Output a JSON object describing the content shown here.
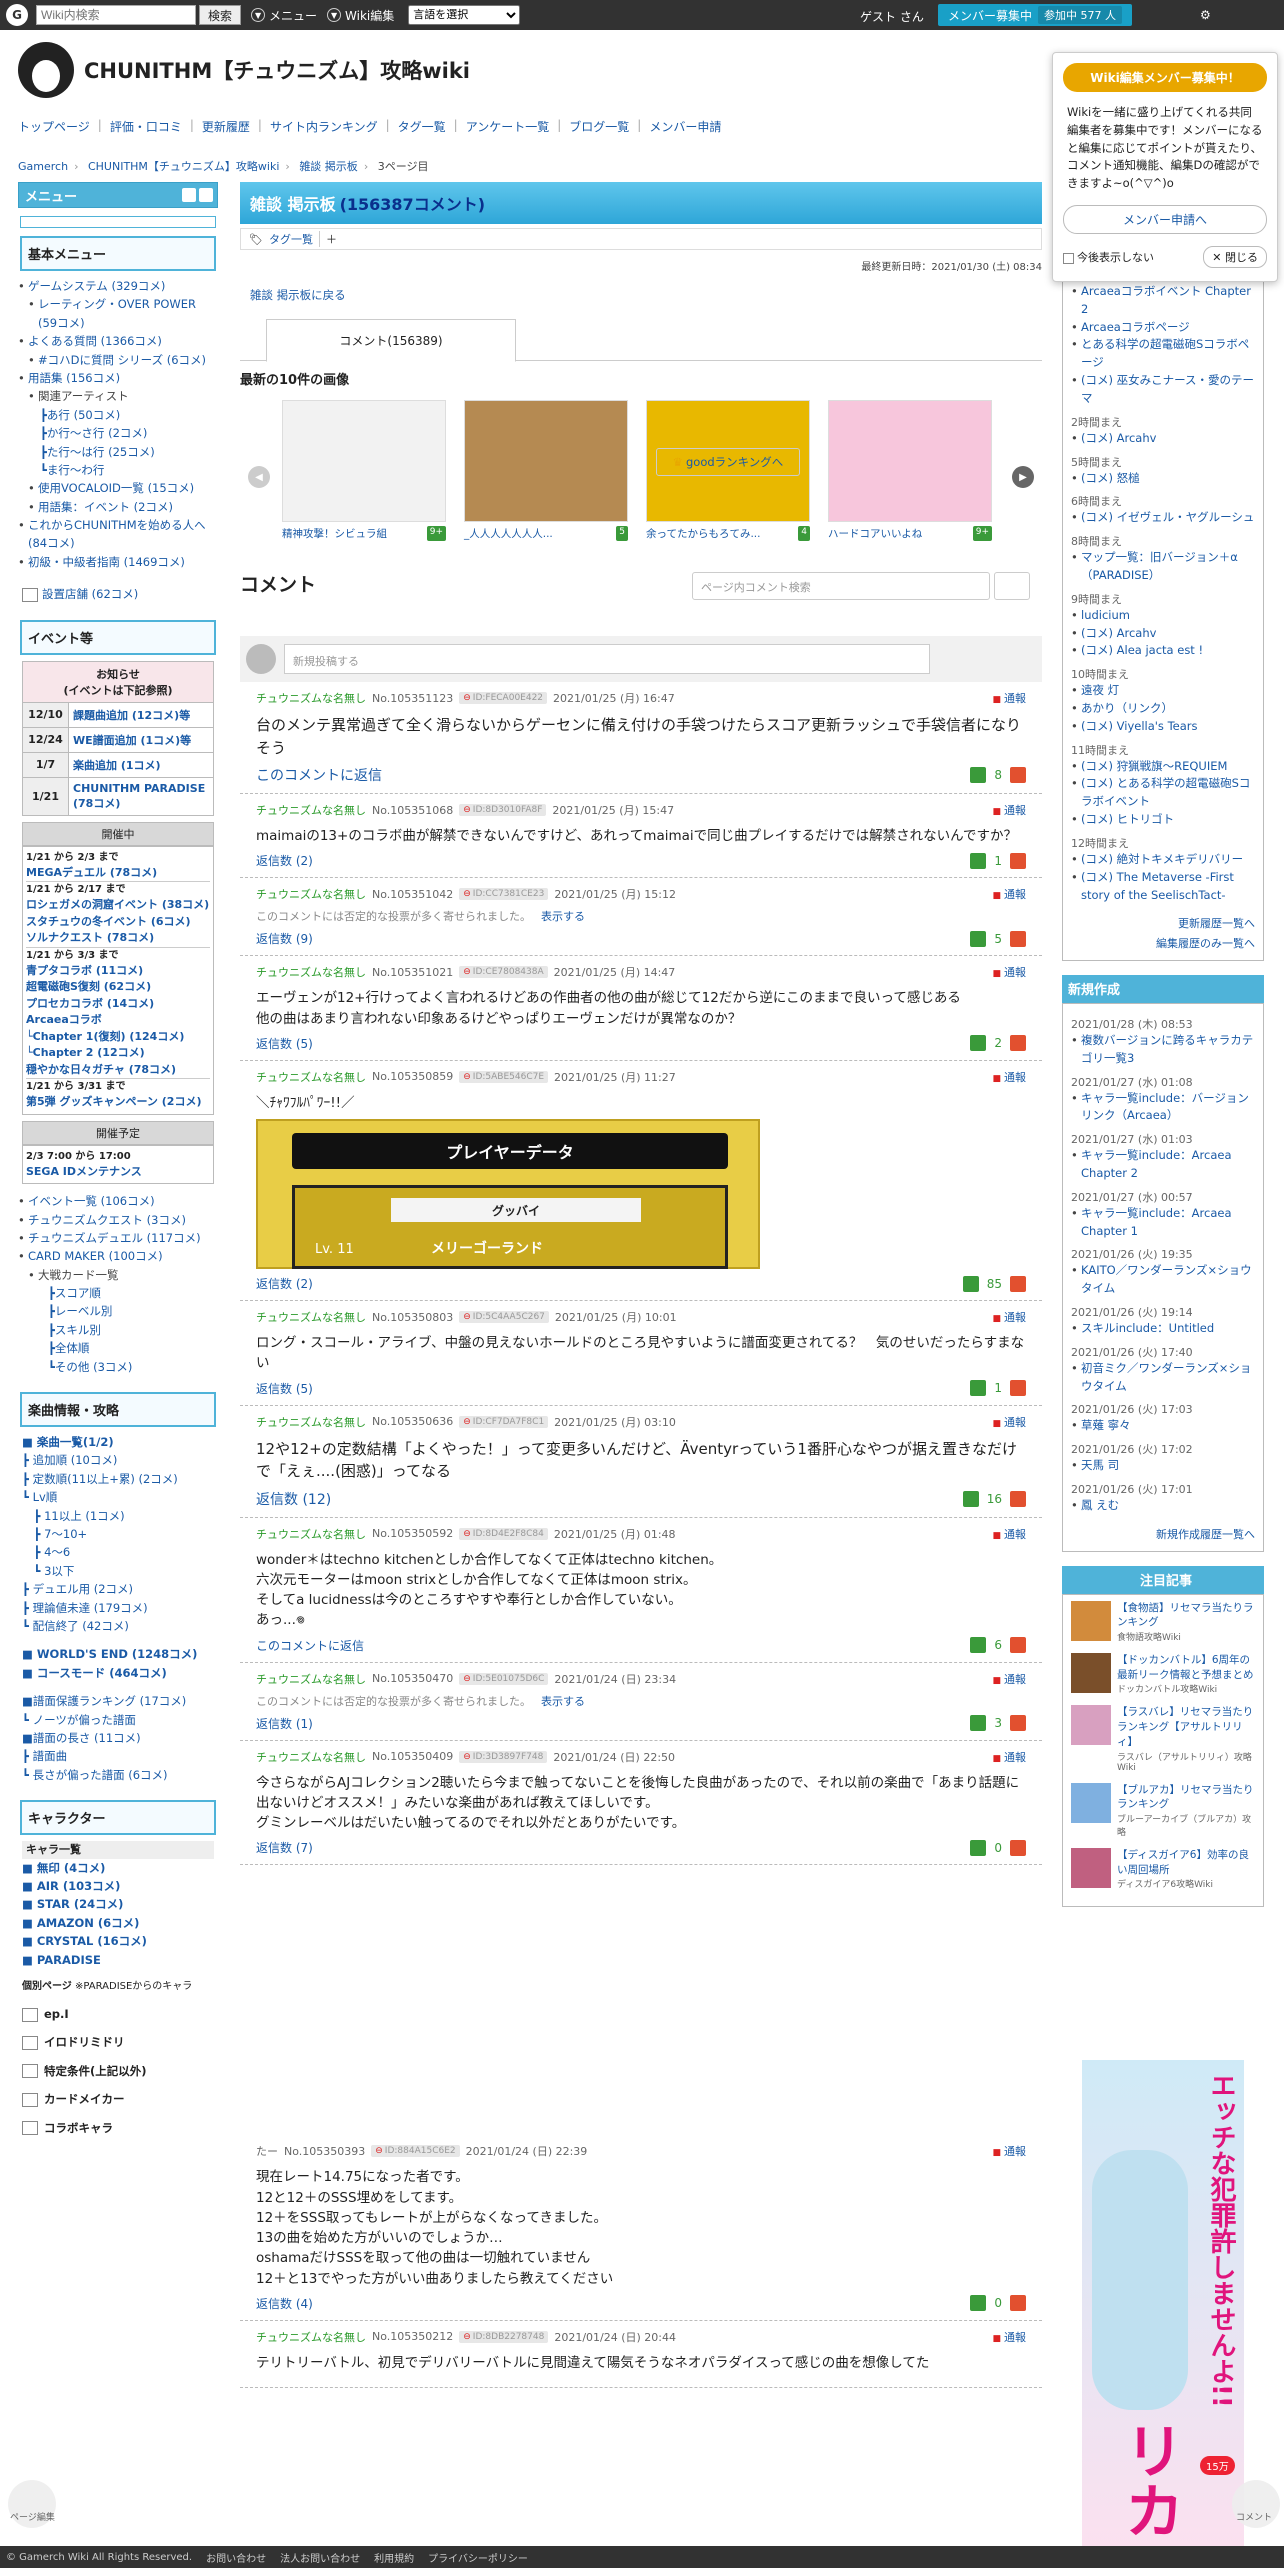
{
  "topbar": {
    "search_placeholder": "Wiki内検索",
    "search_btn": "検索",
    "menu": "メニュー",
    "wiki_edit": "Wiki編集",
    "lang": "言語を選択",
    "guest": "ゲスト さん",
    "member_btn": "メンバー募集中",
    "member_count": "参加中 577 人"
  },
  "site": {
    "title": "CHUNITHM【チュウニズム】攻略wiki"
  },
  "gnav": [
    "トップページ",
    "評価・口コミ",
    "更新履歴",
    "サイト内ランキング",
    "タグ一覧",
    "アンケート一覧",
    "ブログ一覧",
    "メンバー申請"
  ],
  "breadcrumb": [
    "Gamerch",
    "CHUNITHM【チュウニズム】攻略wiki",
    "雑談 掲示板",
    "3ページ目"
  ],
  "popup": {
    "title": "Wiki編集メンバー募集中！",
    "text": "Wikiを一緒に盛り上げてくれる共同編集者を募集中です！メンバーになると編集に応じてポイントが貰えたり、コメント通知機能、編集Dの確認ができますよ~o(^▽^)o",
    "apply": "メンバー申請へ",
    "hide": "今後表示しない",
    "close": "閉じる"
  },
  "left": {
    "menu_title": "メニュー",
    "basic_title": "基本メニュー",
    "basic": [
      "ゲームシステム (329コメ)",
      "レーティング・OVER POWER (59コメ)",
      "よくある質問 (1366コメ)",
      "#コハDに質問 シリーズ (6コメ)",
      "用語集 (156コメ)",
      "関連アーティスト",
      "┣あ行 (50コメ)",
      "┣か行～さ行 (2コメ)",
      "┣た行～は行 (25コメ)",
      "┗ま行～わ行",
      "使用VOCALOID一覧 (15コメ)",
      "用語集：イベント (2コメ)",
      "これからCHUNITHMを始める人へ (84コメ)",
      "初級・中級者指南 (1469コメ)"
    ],
    "shop": "設置店舗 (62コメ)",
    "event_title": "イベント等",
    "notice_head": "お知らせ\n(イベントは下記参照)",
    "notices": [
      {
        "d": "12/10",
        "t": "課題曲追加 (12コメ)等"
      },
      {
        "d": "12/24",
        "t": "WE譜面追加 (1コメ)等"
      },
      {
        "d": "1/7",
        "t": "楽曲追加 (1コメ)"
      },
      {
        "d": "1/21",
        "t": "CHUNITHM PARADISE (78コメ)"
      }
    ],
    "open_title": "開催中",
    "open": [
      "1/21 から 2/3 まで",
      "MEGAデュエル (78コメ)",
      "1/21 から 2/17 まで",
      "ロシェガメの洞窟イベント (38コメ)",
      "スタチュウの冬イベント (6コメ)",
      "ソルナクエスト (78コメ)",
      "1/21 から 3/3 まで",
      "青プタコラボ (11コメ)",
      "超電磁砲S復刻 (62コメ)",
      "プロセカコラボ (14コメ)",
      "Arcaeaコラボ",
      "└Chapter 1(復刻) (124コメ)",
      "└Chapter 2 (12コメ)",
      "穏やかな日々ガチャ (78コメ)",
      "1/21 から 3/31 まで",
      "第5弾 グッズキャンペーン (2コメ)"
    ],
    "plan_title": "開催予定",
    "plan": [
      "2/3 7:00 から 17:00",
      "SEGA IDメンテナンス"
    ],
    "events": [
      "イベント一覧 (106コメ)",
      "チュウニズムクエスト (3コメ)",
      "チュウニズムデュエル (117コメ)",
      "CARD MAKER (100コメ)",
      "大戦カード一覧",
      "┣スコア順",
      "┣レーベル別",
      "┣スキル別",
      "┣全体順",
      "┗その他 (3コメ)"
    ],
    "songs_title": "楽曲情報・攻略",
    "songs": [
      "■ 楽曲一覧(1/2)",
      "┣ 追加順 (10コメ)",
      "┣ 定数順(11以上+累) (2コメ)",
      "┗ Lv順",
      "　┣ 11以上 (1コメ)",
      "　┣ 7～10+",
      "　┣ 4～6",
      "　┗ 3以下",
      "┣ デュエル用 (2コメ)",
      "┣ 理論値未達 (179コメ)",
      "┗ 配信終了 (42コメ)",
      "■ WORLD'S END (1248コメ)",
      "■ コースモード (464コメ)",
      "■譜面保護ランキング (17コメ)",
      "┗ ノーツが偏った譜面",
      "■譜面の長さ (11コメ)",
      "┣ 譜面曲",
      "┗ 長さが偏った譜面 (6コメ)"
    ],
    "chara_title": "キャラクター",
    "chara": [
      "キャラ一覧",
      "■ 無印 (4コメ)",
      "■ AIR (103コメ)",
      "■ STAR (24コメ)",
      "■ AMAZON (6コメ)",
      "■ CRYSTAL (16コメ)",
      "■ PARADISE"
    ],
    "personal": "個別ページ",
    "personal_note": "※PARADISEからのキャラ",
    "personal_items": [
      "ep.I",
      "イロドリミドリ",
      "特定条件(上記以外)",
      "カードメイカー",
      "コラボキャラ"
    ]
  },
  "main": {
    "title": "雑談 掲示板",
    "count": "(156387コメント)",
    "tag_list": "タグ一覧",
    "updated": "最終更新日時：2021/01/30 (土) 08:34",
    "back": "雑談 掲示板に戻る",
    "tab": "コメント(156389)",
    "images_title": "最新の10件の画像",
    "images": [
      {
        "cap": "精神攻撃！シビュラ組",
        "g": "9+"
      },
      {
        "cap": "_人人人人人人人...",
        "g": "5"
      },
      {
        "cap": "余ってたからもろてみ...",
        "g": "4"
      },
      {
        "cap": "ハードコアいいよね",
        "g": "9+"
      }
    ],
    "comments_title": "コメント",
    "search_placeholder": "ページ内コメント検索",
    "good_rank": "goodランキングへ",
    "new_post": "新規投稿する",
    "comments": [
      {
        "name": "チュウニズムな名無し",
        "no": "No.105351123",
        "id": "ID:FECA00E422",
        "date": "2021/01/25 (月) 16:47",
        "body": "台のメンテ異常過ぎて全く滑らないからゲーセンに備え付けの手袋つけたらスコア更新ラッシュで手袋信者になりそう",
        "foot": "このコメントに返信",
        "up": "8",
        "big": true
      },
      {
        "name": "チュウニズムな名無し",
        "no": "No.105351068",
        "id": "ID:8D3010FA8F",
        "date": "2021/01/25 (月) 15:47",
        "body": "maimaiの13+のコラボ曲が解禁できないんですけど、あれってmaimaiで同じ曲プレイするだけでは解禁されないんですか？",
        "foot": "返信数 (2)",
        "up": "1"
      },
      {
        "name": "チュウニズムな名無し",
        "no": "No.105351042",
        "id": "ID:CC7381CE23",
        "date": "2021/01/25 (月) 15:12",
        "neg": "このコメントには否定的な投票が多く寄せられました。",
        "show": "表示する",
        "foot": "返信数 (9)",
        "up": "5"
      },
      {
        "name": "チュウニズムな名無し",
        "no": "No.105351021",
        "id": "ID:CE7808438A",
        "date": "2021/01/25 (月) 14:47",
        "body": "エーヴェンが12+行けってよく言われるけどあの作曲者の他の曲が総じて12だから逆にこのままで良いって感じある\n他の曲はあまり言われない印象あるけどやっぱりエーヴェンだけが異常なのか？",
        "foot": "返信数 (5)",
        "up": "2"
      },
      {
        "name": "チュウニズムな名無し",
        "no": "No.105350859",
        "id": "ID:5ABE546C7E",
        "date": "2021/01/25 (月) 11:27",
        "body": "＼ﾁｬﾜﾌﾙﾊﾟﾜｰ!!／",
        "player": {
          "h": "プレイヤーデータ",
          "n": "グッバイ",
          "lv": "Lv. 11",
          "t": "メリーゴーランド"
        },
        "foot": "返信数 (2)",
        "up": "85"
      },
      {
        "name": "チュウニズムな名無し",
        "no": "No.105350803",
        "id": "ID:5C4AA5C267",
        "date": "2021/01/25 (月) 10:01",
        "body": "ロング・スコール・アライブ、中盤の見えないホールドのところ見やすいように譜面変更されてる？　気のせいだったらすまない",
        "foot": "返信数 (5)",
        "up": "1"
      },
      {
        "name": "チュウニズムな名無し",
        "no": "No.105350636",
        "id": "ID:CF7DA7F8C1",
        "date": "2021/01/25 (月) 03:10",
        "body": "12や12+の定数結構「よくやった！」って変更多いんだけど、Äventyrっていう1番肝心なやつが据え置きなだけで「えぇ....(困惑)」ってなる",
        "foot": "返信数 (12)",
        "up": "16",
        "big": true
      },
      {
        "name": "チュウニズムな名無し",
        "no": "No.105350592",
        "id": "ID:8D4E2F8C84",
        "date": "2021/01/25 (月) 01:48",
        "body": "wonder＊はtechno kitchenとしか合作してなくて正体はtechno kitchen。\n六次元モーターはmoon strixとしか合作してなくて正体はmoon strix。\nそしてa lucidnessは今のところすやすや奉行としか合作していない。\nあっ...𖦹",
        "foot": "このコメントに返信",
        "up": "6"
      },
      {
        "name": "チュウニズムな名無し",
        "no": "No.105350470",
        "id": "ID:5E01075D6C",
        "date": "2021/01/24 (日) 23:34",
        "neg": "このコメントには否定的な投票が多く寄せられました。",
        "show": "表示する",
        "foot": "返信数 (1)",
        "up": "3"
      },
      {
        "name": "チュウニズムな名無し",
        "no": "No.105350409",
        "id": "ID:3D3897F748",
        "date": "2021/01/24 (日) 22:50",
        "body": "今さらながらAJコレクション2聴いたら今まで触ってないことを後悔した良曲があったので、それ以前の楽曲で「あまり話題に出ないけどオススメ！」みたいな楽曲があれば教えてほしいです。\nグミンレーベルはだいたい触ってるのでそれ以外だとありがたいです。",
        "foot": "返信数 (7)",
        "up": "0"
      },
      {
        "name": "たー",
        "no": "No.105350393",
        "id": "ID:884A15C6E2",
        "date": "2021/01/24 (日) 22:39",
        "body": "現在レート14.75になった者です。\n12と12＋のSSS埋めをしてます。\n12＋をSSS取ってもレートが上がらなくなってきました。\n13の曲を始めた方がいいのでしょうか…\noshamaだけSSSを取って他の曲は一切触れていません\n12＋と13でやった方がいい曲ありましたら教えてください",
        "foot": "返信数 (4)",
        "up": "0"
      },
      {
        "name": "チュウニズムな名無し",
        "no": "No.105350212",
        "id": "ID:8DB2278748",
        "date": "2021/01/24 (日) 20:44",
        "body": "テリトリーバトル、初見でデリバリーバトルに見間違えて陽気そうなネオパラダイスって感じの曲を想像してた",
        "foot": "",
        "up": ""
      }
    ]
  },
  "right": {
    "recent_top": [
      "Arcaeaコラボイベント Chapter 2",
      "Arcaeaコラボページ",
      "とある科学の超電磁砲Sコラボページ",
      "(コメ) 巫女みこナース・愛のテーマ"
    ],
    "groups": [
      {
        "t": "2時間まえ",
        "i": [
          "(コメ) Arcahv"
        ]
      },
      {
        "t": "5時間まえ",
        "i": [
          "(コメ) 怒槌"
        ]
      },
      {
        "t": "6時間まえ",
        "i": [
          "(コメ) イゼヴェル・ヤグルーシュ"
        ]
      },
      {
        "t": "8時間まえ",
        "i": [
          "マップ一覧：旧バージョン＋α（PARADISE）"
        ]
      },
      {
        "t": "9時間まえ",
        "i": [
          "ludicium",
          "(コメ) Arcahv",
          "(コメ) Alea jacta est !"
        ]
      },
      {
        "t": "10時間まえ",
        "i": [
          "遠夜 灯",
          "あかり（リンク）",
          "(コメ) Viyella's Tears"
        ]
      },
      {
        "t": "11時間まえ",
        "i": [
          "(コメ) 狩猟戦旗～REQUIEM",
          "(コメ) とある科学の超電磁砲Sコラボイベント",
          "(コメ) ヒトリゴト"
        ]
      },
      {
        "t": "12時間まえ",
        "i": [
          "(コメ) 絶対トキメキデリバリー",
          "(コメ) The Metaverse -First story of the SeelischTact-"
        ]
      }
    ],
    "more1": "更新履歴一覧へ",
    "more2": "編集履歴のみ一覧へ",
    "new_title": "新規作成",
    "new": [
      {
        "t": "2021/01/28 (木) 08:53",
        "i": "複数バージョンに跨るキャラカテゴリ一覧3"
      },
      {
        "t": "2021/01/27 (水) 01:08",
        "i": "キャラ一覧include：バージョンリンク（Arcaea）"
      },
      {
        "t": "2021/01/27 (水) 01:03",
        "i": "キャラ一覧include：Arcaea Chapter 2"
      },
      {
        "t": "2021/01/27 (水) 00:57",
        "i": "キャラ一覧include：Arcaea Chapter 1"
      },
      {
        "t": "2021/01/26 (火) 19:35",
        "i": "KAITO／ワンダーランズ×ショウタイム"
      },
      {
        "t": "2021/01/26 (火) 19:14",
        "i": "スキルinclude：Untitled"
      },
      {
        "t": "2021/01/26 (火) 17:40",
        "i": "初音ミク／ワンダーランズ×ショウタイム"
      },
      {
        "t": "2021/01/26 (火) 17:03",
        "i": "草薙 寧々"
      },
      {
        "t": "2021/01/26 (火) 17:02",
        "i": "天馬 司"
      },
      {
        "t": "2021/01/26 (火) 17:01",
        "i": "鳳 えむ"
      }
    ],
    "new_more": "新規作成履歴一覧へ",
    "att_title": "注目記事",
    "att": [
      {
        "t": "【食物語】リセマラ当たりランキング",
        "s": "食物語攻略Wiki"
      },
      {
        "t": "【ドッカンバトル】6周年の最新リーク情報と予想まとめ",
        "s": "ドッカンバトル攻略Wiki"
      },
      {
        "t": "【ラスバレ】リセマラ当たりランキング【アサルトリリィ】",
        "s": "ラスバレ（アサルトリリィ）攻略Wiki"
      },
      {
        "t": "【ブルアカ】リセマラ当たりランキング",
        "s": "ブルーアーカイブ（ブルアカ）攻略"
      },
      {
        "t": "【ディスガイア6】効率の良い周回場所",
        "s": "ディスガイア6攻略Wiki"
      }
    ],
    "ad_text": "エッチな犯罪許しませんよ!!",
    "ad_brand": "リカ",
    "ad_badge": "15万"
  },
  "footer": [
    "© Gamerch Wiki All Rights Reserved.",
    "お問い合わせ",
    "法人お問い合わせ",
    "利用規約",
    "プライバシーポリシー"
  ],
  "corner": {
    "left": "ページ編集",
    "right": "コメント"
  }
}
